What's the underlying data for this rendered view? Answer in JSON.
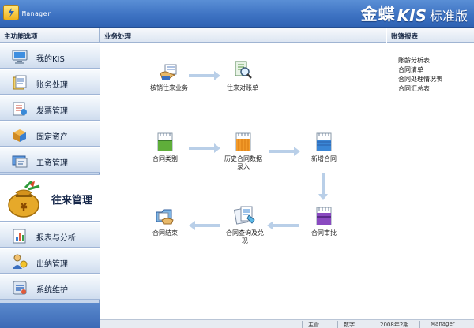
{
  "window": {
    "title": "Manager",
    "brand_main": "金蝶",
    "brand_kis": "KIS",
    "brand_edition": "标准版"
  },
  "headers": {
    "sidebar": "主功能选项",
    "main": "业务处理",
    "right": "账簿报表"
  },
  "sidebar": {
    "items": [
      {
        "label": "我的KIS",
        "icon": "monitor-icon"
      },
      {
        "label": "账务处理",
        "icon": "ledger-icon"
      },
      {
        "label": "发票管理",
        "icon": "invoice-icon"
      },
      {
        "label": "固定资产",
        "icon": "box-icon"
      },
      {
        "label": "工资管理",
        "icon": "salary-icon"
      }
    ],
    "active": {
      "label": "往来管理",
      "icon": "money-bag-icon"
    },
    "items_after": [
      {
        "label": "报表与分析",
        "icon": "report-icon"
      },
      {
        "label": "出纳管理",
        "icon": "cashier-icon"
      },
      {
        "label": "系统维护",
        "icon": "settings-icon"
      }
    ]
  },
  "flow": {
    "nodes": [
      {
        "id": "writeoff",
        "label": "核销往来业务"
      },
      {
        "id": "statement",
        "label": "往来对账单"
      },
      {
        "id": "contract-type",
        "label": "合同类别"
      },
      {
        "id": "history",
        "label_line1": "历史合同数据",
        "label_line2": "录入"
      },
      {
        "id": "new-contract",
        "label": "新增合同"
      },
      {
        "id": "approve",
        "label": "合同审批"
      },
      {
        "id": "query",
        "label_line1": "合同查询及兑",
        "label_line2": "现"
      },
      {
        "id": "close",
        "label": "合同结束"
      }
    ]
  },
  "reports": {
    "items": [
      "账龄分析表",
      "合同清单",
      "合同处理情况表",
      "合同汇总表"
    ]
  },
  "status": {
    "user_mode": "主管",
    "input_mode": "数字",
    "period": "2008年2期",
    "user": "Manager"
  },
  "colors": {
    "titlebar": "#3e73c3",
    "sidebar_bg": "#c6d6ec",
    "arrow": "#b9cfe8"
  }
}
